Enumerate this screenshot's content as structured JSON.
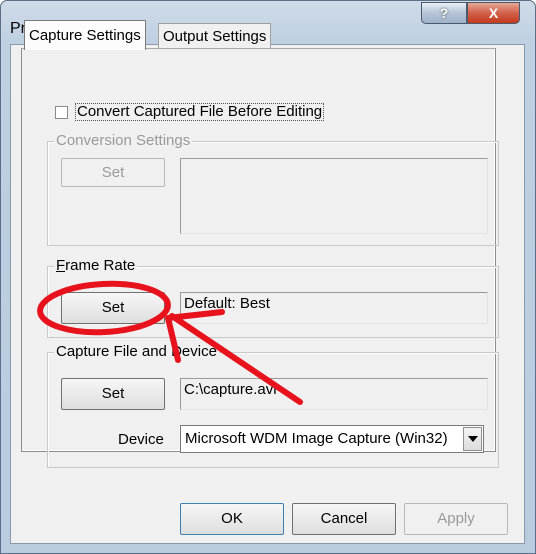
{
  "window": {
    "title": "Preferences",
    "help_glyph": "?",
    "close_glyph": "X"
  },
  "tabs": [
    {
      "label": "Capture Settings",
      "active": true
    },
    {
      "label": "Output Settings",
      "active": false
    }
  ],
  "convert_checkbox": {
    "label": "Convert Captured File Before Editing",
    "checked": false
  },
  "conversion_settings": {
    "legend": "Conversion Settings",
    "set_label": "Set",
    "value": "",
    "enabled": false
  },
  "frame_rate": {
    "legend": "Frame Rate",
    "set_label": "Set",
    "value": "Default: Best"
  },
  "capture_file": {
    "legend": "Capture File and Device",
    "set_label": "Set",
    "value": "C:\\capture.avi",
    "device_label": "Device",
    "device_value": "Microsoft WDM Image Capture (Win32)"
  },
  "footer": {
    "ok_label": "OK",
    "cancel_label": "Cancel",
    "apply_label": "Apply"
  },
  "colors": {
    "annotation": "#e8121c",
    "titlebar": "#bfd0e2",
    "close_button": "#c3391c"
  },
  "icons": {
    "help": "question-mark-icon",
    "close": "close-icon",
    "dropdown": "chevron-down-icon"
  }
}
